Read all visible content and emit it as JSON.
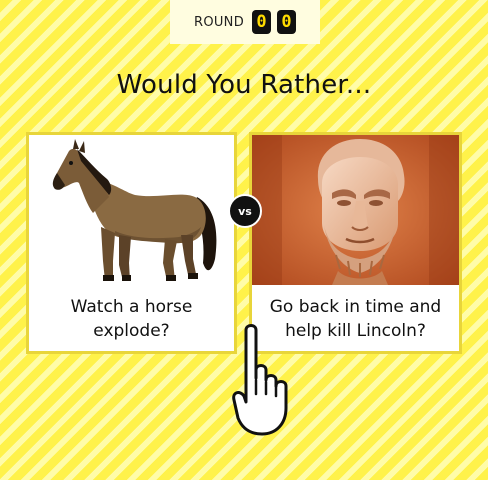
{
  "round": {
    "label": "ROUND",
    "digits": [
      "0",
      "0"
    ]
  },
  "title": "Would You Rather...",
  "vs_label": "vs",
  "options": [
    {
      "text_line1": "Watch a horse",
      "text_line2": "explode?",
      "image": "horse-image"
    },
    {
      "text_line1": "Go back in time and",
      "text_line2": "help kill Lincoln?",
      "image": "lincoln-statue-image"
    }
  ],
  "colors": {
    "background": "#fff24a",
    "stripe": "#fffca8",
    "card_border": "#e8d53a",
    "digit_text": "#ffdc00"
  },
  "icons": {
    "cursor": "hand-pointer-icon"
  }
}
